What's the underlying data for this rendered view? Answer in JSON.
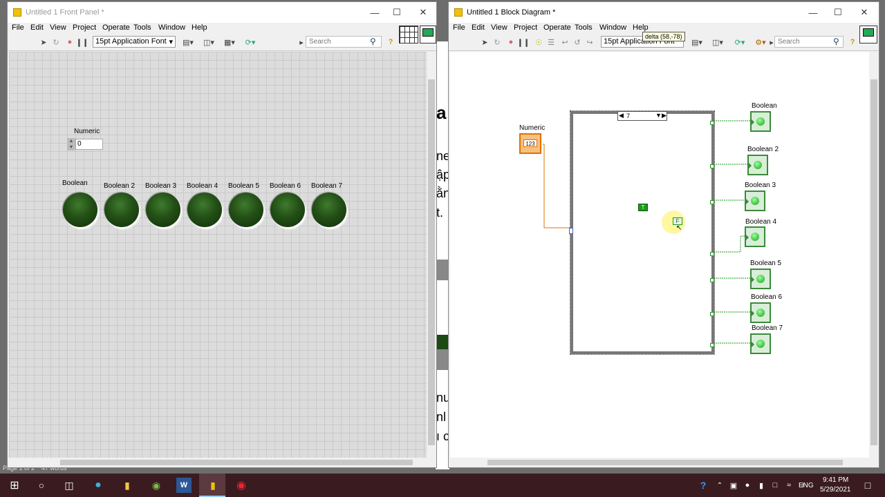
{
  "front_panel": {
    "title": "Untitled 1 Front Panel *",
    "menus": [
      "File",
      "Edit",
      "View",
      "Project",
      "Operate",
      "Tools",
      "Window",
      "Help"
    ],
    "font_label": "15pt Application Font",
    "search_placeholder": "Search",
    "numeric": {
      "label": "Numeric",
      "value": "0"
    },
    "booleans": [
      "Boolean",
      "Boolean 2",
      "Boolean 3",
      "Boolean 4",
      "Boolean 5",
      "Boolean 6",
      "Boolean 7"
    ]
  },
  "block_diagram": {
    "title": "Untitled 1 Block Diagram *",
    "menus": [
      "File",
      "Edit",
      "View",
      "Project",
      "Operate",
      "Tools",
      "Window",
      "Help"
    ],
    "font_label": "15pt Application Font",
    "tooltip": "delta (58,-78)",
    "search_placeholder": "Search",
    "numeric_label": "Numeric",
    "numeric_terminal": "123",
    "case_selector": "7",
    "true_const": "T",
    "false_const": "F",
    "indicators": [
      "Boolean",
      "Boolean 2",
      "Boolean 3",
      "Boolean 4",
      "Boolean 5",
      "Boolean 6",
      "Boolean 7"
    ]
  },
  "background_doc": {
    "fragments": [
      "a",
      "ne",
      "ập",
      "ằn",
      "t.",
      "nu",
      "nl",
      "ı c"
    ]
  },
  "status": {
    "page": "Page 1 of 2",
    "words": "47 words"
  },
  "taskbar": {
    "lang": "ENG",
    "time": "9:41 PM",
    "date": "5/29/2021"
  },
  "colors": {
    "led_off": "#234f16",
    "wire_numeric": "#e07000",
    "wire_bool": "#1a9a1a",
    "taskbar": "#3a1c20"
  }
}
